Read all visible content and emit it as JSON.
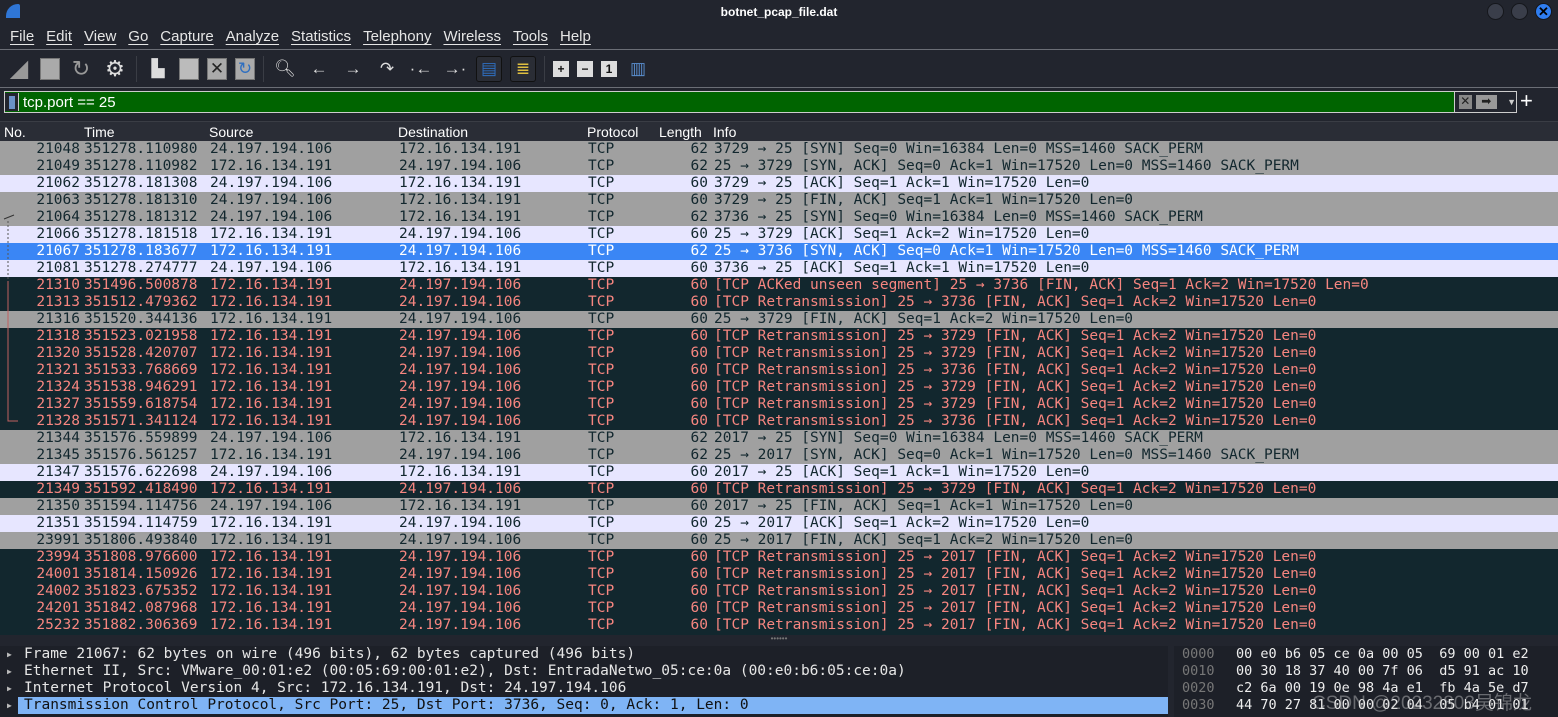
{
  "window": {
    "title": "botnet_pcap_file.dat"
  },
  "menu": [
    "File",
    "Edit",
    "View",
    "Go",
    "Capture",
    "Analyze",
    "Statistics",
    "Telephony",
    "Wireless",
    "Tools",
    "Help"
  ],
  "toolbar": {
    "icons": [
      "start-capture",
      "stop-capture",
      "restart-capture",
      "capture-options",
      "open-file",
      "save-file",
      "close-file",
      "reload-file",
      "find-packet",
      "go-back",
      "go-forward",
      "go-to-packet",
      "previous-packet",
      "next-packet",
      "auto-scroll",
      "colorize",
      "zoom-in",
      "zoom-out",
      "normal-size",
      "resize-columns"
    ]
  },
  "filter": {
    "value": "tcp.port == 25",
    "background": "#006400"
  },
  "columns": [
    "No.",
    "Time",
    "Source",
    "Destination",
    "Protocol",
    "Length",
    "Info"
  ],
  "colors": {
    "syn_fin": "#a0a0a0",
    "ack": "#e7e6ff",
    "selected": "#3a86f5",
    "bad_tcp_bg": "#12272e",
    "bad_tcp_fg": "#f78680"
  },
  "packets": [
    {
      "type": "gray",
      "no": "21048",
      "time": "351278.110980",
      "src": "24.197.194.106",
      "dst": "172.16.134.191",
      "proto": "TCP",
      "len": "62",
      "info": "3729 → 25 [SYN] Seq=0 Win=16384 Len=0 MSS=1460 SACK_PERM"
    },
    {
      "type": "gray",
      "no": "21049",
      "time": "351278.110982",
      "src": "172.16.134.191",
      "dst": "24.197.194.106",
      "proto": "TCP",
      "len": "62",
      "info": "25 → 3729 [SYN, ACK] Seq=0 Ack=1 Win=17520 Len=0 MSS=1460 SACK_PERM"
    },
    {
      "type": "light",
      "no": "21062",
      "time": "351278.181308",
      "src": "24.197.194.106",
      "dst": "172.16.134.191",
      "proto": "TCP",
      "len": "60",
      "info": "3729 → 25 [ACK] Seq=1 Ack=1 Win=17520 Len=0"
    },
    {
      "type": "gray",
      "no": "21063",
      "time": "351278.181310",
      "src": "24.197.194.106",
      "dst": "172.16.134.191",
      "proto": "TCP",
      "len": "60",
      "info": "3729 → 25 [FIN, ACK] Seq=1 Ack=1 Win=17520 Len=0"
    },
    {
      "type": "gray",
      "no": "21064",
      "time": "351278.181312",
      "src": "24.197.194.106",
      "dst": "172.16.134.191",
      "proto": "TCP",
      "len": "62",
      "info": "3736 → 25 [SYN] Seq=0 Win=16384 Len=0 MSS=1460 SACK_PERM"
    },
    {
      "type": "light",
      "no": "21066",
      "time": "351278.181518",
      "src": "172.16.134.191",
      "dst": "24.197.194.106",
      "proto": "TCP",
      "len": "60",
      "info": "25 → 3729 [ACK] Seq=1 Ack=2 Win=17520 Len=0"
    },
    {
      "type": "sel",
      "no": "21067",
      "time": "351278.183677",
      "src": "172.16.134.191",
      "dst": "24.197.194.106",
      "proto": "TCP",
      "len": "62",
      "info": "25 → 3736 [SYN, ACK] Seq=0 Ack=1 Win=17520 Len=0 MSS=1460 SACK_PERM"
    },
    {
      "type": "light",
      "no": "21081",
      "time": "351278.274777",
      "src": "24.197.194.106",
      "dst": "172.16.134.191",
      "proto": "TCP",
      "len": "60",
      "info": "3736 → 25 [ACK] Seq=1 Ack=1 Win=17520 Len=0"
    },
    {
      "type": "bad",
      "no": "21310",
      "time": "351496.500878",
      "src": "172.16.134.191",
      "dst": "24.197.194.106",
      "proto": "TCP",
      "len": "60",
      "info": "[TCP ACKed unseen segment] 25 → 3736 [FIN, ACK] Seq=1 Ack=2 Win=17520 Len=0"
    },
    {
      "type": "bad",
      "no": "21313",
      "time": "351512.479362",
      "src": "172.16.134.191",
      "dst": "24.197.194.106",
      "proto": "TCP",
      "len": "60",
      "info": "[TCP Retransmission] 25 → 3736 [FIN, ACK] Seq=1 Ack=2 Win=17520 Len=0"
    },
    {
      "type": "gray",
      "no": "21316",
      "time": "351520.344136",
      "src": "172.16.134.191",
      "dst": "24.197.194.106",
      "proto": "TCP",
      "len": "60",
      "info": "25 → 3729 [FIN, ACK] Seq=1 Ack=2 Win=17520 Len=0"
    },
    {
      "type": "bad",
      "no": "21318",
      "time": "351523.021958",
      "src": "172.16.134.191",
      "dst": "24.197.194.106",
      "proto": "TCP",
      "len": "60",
      "info": "[TCP Retransmission] 25 → 3729 [FIN, ACK] Seq=1 Ack=2 Win=17520 Len=0"
    },
    {
      "type": "bad",
      "no": "21320",
      "time": "351528.420707",
      "src": "172.16.134.191",
      "dst": "24.197.194.106",
      "proto": "TCP",
      "len": "60",
      "info": "[TCP Retransmission] 25 → 3729 [FIN, ACK] Seq=1 Ack=2 Win=17520 Len=0"
    },
    {
      "type": "bad",
      "no": "21321",
      "time": "351533.768669",
      "src": "172.16.134.191",
      "dst": "24.197.194.106",
      "proto": "TCP",
      "len": "60",
      "info": "[TCP Retransmission] 25 → 3736 [FIN, ACK] Seq=1 Ack=2 Win=17520 Len=0"
    },
    {
      "type": "bad",
      "no": "21324",
      "time": "351538.946291",
      "src": "172.16.134.191",
      "dst": "24.197.194.106",
      "proto": "TCP",
      "len": "60",
      "info": "[TCP Retransmission] 25 → 3729 [FIN, ACK] Seq=1 Ack=2 Win=17520 Len=0"
    },
    {
      "type": "bad",
      "no": "21327",
      "time": "351559.618754",
      "src": "172.16.134.191",
      "dst": "24.197.194.106",
      "proto": "TCP",
      "len": "60",
      "info": "[TCP Retransmission] 25 → 3729 [FIN, ACK] Seq=1 Ack=2 Win=17520 Len=0"
    },
    {
      "type": "bad",
      "no": "21328",
      "time": "351571.341124",
      "src": "172.16.134.191",
      "dst": "24.197.194.106",
      "proto": "TCP",
      "len": "60",
      "info": "[TCP Retransmission] 25 → 3736 [FIN, ACK] Seq=1 Ack=2 Win=17520 Len=0"
    },
    {
      "type": "gray",
      "no": "21344",
      "time": "351576.559899",
      "src": "24.197.194.106",
      "dst": "172.16.134.191",
      "proto": "TCP",
      "len": "62",
      "info": "2017 → 25 [SYN] Seq=0 Win=16384 Len=0 MSS=1460 SACK_PERM"
    },
    {
      "type": "gray",
      "no": "21345",
      "time": "351576.561257",
      "src": "172.16.134.191",
      "dst": "24.197.194.106",
      "proto": "TCP",
      "len": "62",
      "info": "25 → 2017 [SYN, ACK] Seq=0 Ack=1 Win=17520 Len=0 MSS=1460 SACK_PERM"
    },
    {
      "type": "light",
      "no": "21347",
      "time": "351576.622698",
      "src": "24.197.194.106",
      "dst": "172.16.134.191",
      "proto": "TCP",
      "len": "60",
      "info": "2017 → 25 [ACK] Seq=1 Ack=1 Win=17520 Len=0"
    },
    {
      "type": "bad",
      "no": "21349",
      "time": "351592.418490",
      "src": "172.16.134.191",
      "dst": "24.197.194.106",
      "proto": "TCP",
      "len": "60",
      "info": "[TCP Retransmission] 25 → 3729 [FIN, ACK] Seq=1 Ack=2 Win=17520 Len=0"
    },
    {
      "type": "gray",
      "no": "21350",
      "time": "351594.114756",
      "src": "24.197.194.106",
      "dst": "172.16.134.191",
      "proto": "TCP",
      "len": "60",
      "info": "2017 → 25 [FIN, ACK] Seq=1 Ack=1 Win=17520 Len=0"
    },
    {
      "type": "light",
      "no": "21351",
      "time": "351594.114759",
      "src": "172.16.134.191",
      "dst": "24.197.194.106",
      "proto": "TCP",
      "len": "60",
      "info": "25 → 2017 [ACK] Seq=1 Ack=2 Win=17520 Len=0"
    },
    {
      "type": "gray",
      "no": "23991",
      "time": "351806.493840",
      "src": "172.16.134.191",
      "dst": "24.197.194.106",
      "proto": "TCP",
      "len": "60",
      "info": "25 → 2017 [FIN, ACK] Seq=1 Ack=2 Win=17520 Len=0"
    },
    {
      "type": "bad",
      "no": "23994",
      "time": "351808.976600",
      "src": "172.16.134.191",
      "dst": "24.197.194.106",
      "proto": "TCP",
      "len": "60",
      "info": "[TCP Retransmission] 25 → 2017 [FIN, ACK] Seq=1 Ack=2 Win=17520 Len=0"
    },
    {
      "type": "bad",
      "no": "24001",
      "time": "351814.150926",
      "src": "172.16.134.191",
      "dst": "24.197.194.106",
      "proto": "TCP",
      "len": "60",
      "info": "[TCP Retransmission] 25 → 2017 [FIN, ACK] Seq=1 Ack=2 Win=17520 Len=0"
    },
    {
      "type": "bad",
      "no": "24002",
      "time": "351823.675352",
      "src": "172.16.134.191",
      "dst": "24.197.194.106",
      "proto": "TCP",
      "len": "60",
      "info": "[TCP Retransmission] 25 → 2017 [FIN, ACK] Seq=1 Ack=2 Win=17520 Len=0"
    },
    {
      "type": "bad",
      "no": "24201",
      "time": "351842.087968",
      "src": "172.16.134.191",
      "dst": "24.197.194.106",
      "proto": "TCP",
      "len": "60",
      "info": "[TCP Retransmission] 25 → 2017 [FIN, ACK] Seq=1 Ack=2 Win=17520 Len=0"
    },
    {
      "type": "bad",
      "no": "25232",
      "time": "351882.306369",
      "src": "172.16.134.191",
      "dst": "24.197.194.106",
      "proto": "TCP",
      "len": "60",
      "info": "[TCP Retransmission] 25 → 2017 [FIN, ACK] Seq=1 Ack=2 Win=17520 Len=0"
    }
  ],
  "details": [
    {
      "text": "Frame 21067: 62 bytes on wire (496 bits), 62 bytes captured (496 bits)",
      "selected": false
    },
    {
      "text": "Ethernet II, Src: VMware_00:01:e2 (00:05:69:00:01:e2), Dst: EntradaNetwo_05:ce:0a (00:e0:b6:05:ce:0a)",
      "selected": false
    },
    {
      "text": "Internet Protocol Version 4, Src: 172.16.134.191, Dst: 24.197.194.106",
      "selected": false
    },
    {
      "text": "Transmission Control Protocol, Src Port: 25, Dst Port: 3736, Seq: 0, Ack: 1, Len: 0",
      "selected": true
    }
  ],
  "hex": [
    {
      "offset": "0000",
      "bytes": "00 e0 b6 05 ce 0a 00 05  69 00 01 e2"
    },
    {
      "offset": "0010",
      "bytes": "00 30 18 37 40 00 7f 06  d5 91 ac 10"
    },
    {
      "offset": "0020",
      "bytes": "c2 6a 00 19 0e 98 4a e1  fb 4a 5e d7"
    },
    {
      "offset": "0030",
      "bytes": "44 70 27 81 00 00 02 04  05 b4 01 01"
    }
  ],
  "watermark": "CSDN @20232803吴锦龙"
}
